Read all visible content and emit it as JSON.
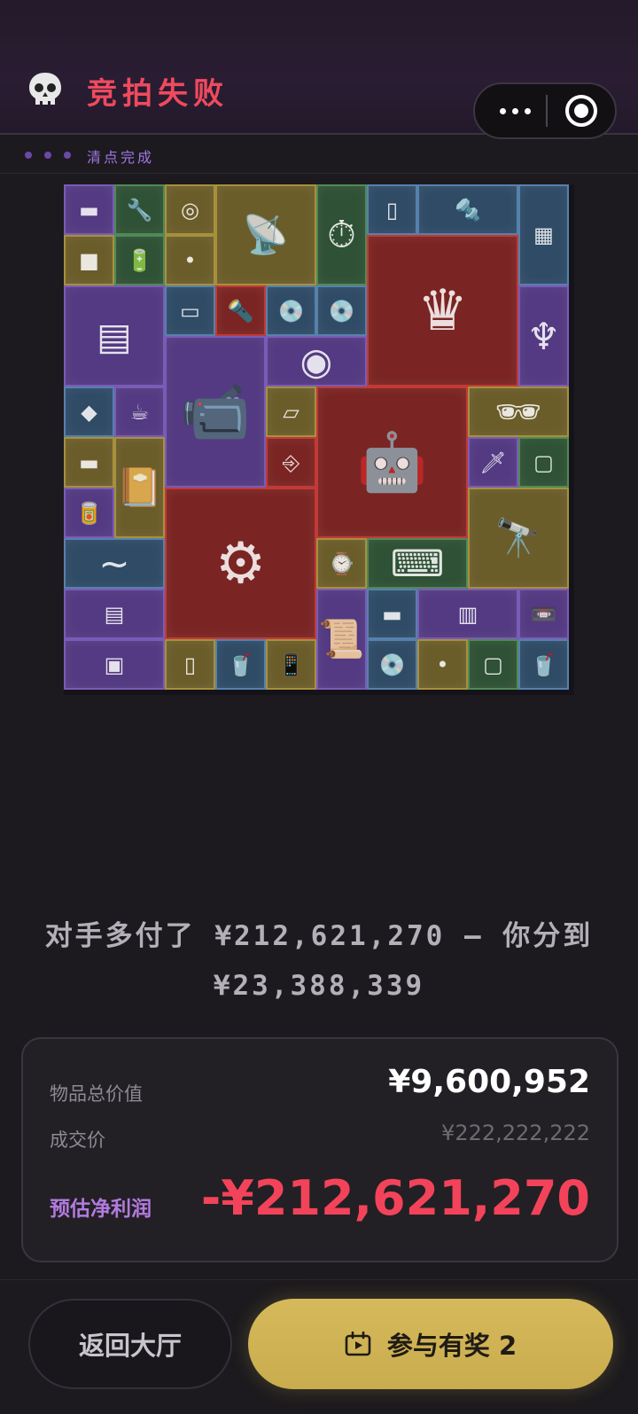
{
  "header": {
    "title": "竞拍失败",
    "status_text": "清点完成",
    "colors": {
      "title": "#ef4a5e",
      "status": "#a177e6"
    }
  },
  "capsule": {
    "more_icon": "more-dots-icon",
    "close_icon": "target-circle-icon"
  },
  "grid": {
    "items": [
      {
        "icon": "memory-stick",
        "glyph": "▬",
        "color": "purple"
      },
      {
        "icon": "wrench",
        "glyph": "🔧",
        "color": "green"
      },
      {
        "icon": "coin",
        "glyph": "◎",
        "color": "gold"
      },
      {
        "icon": "satellite-dish",
        "glyph": "📡",
        "color": "gold"
      },
      {
        "icon": "pressure-gauge",
        "glyph": "⏱",
        "color": "green"
      },
      {
        "icon": "handheld-device",
        "glyph": "▯",
        "color": "blue"
      },
      {
        "icon": "drill",
        "glyph": "🔩",
        "color": "blue"
      },
      {
        "icon": "gift-box",
        "glyph": "▦",
        "color": "blue"
      },
      {
        "icon": "cube",
        "glyph": "■",
        "color": "gold"
      },
      {
        "icon": "battery",
        "glyph": "🔋",
        "color": "green"
      },
      {
        "icon": "ammo",
        "glyph": "•",
        "color": "gold"
      },
      {
        "icon": "chess-board",
        "glyph": "♛",
        "color": "red"
      },
      {
        "icon": "motherboard",
        "glyph": "▤",
        "color": "purple"
      },
      {
        "icon": "ammo-can",
        "glyph": "▭",
        "color": "blue"
      },
      {
        "icon": "flashlight",
        "glyph": "🔦",
        "color": "red"
      },
      {
        "icon": "disc",
        "glyph": "💿",
        "color": "blue"
      },
      {
        "icon": "disc-2",
        "glyph": "💿",
        "color": "blue"
      },
      {
        "icon": "torch-statue",
        "glyph": "♆",
        "color": "purple"
      },
      {
        "icon": "camera-turret",
        "glyph": "📹",
        "color": "purple"
      },
      {
        "icon": "camera-lens",
        "glyph": "◉",
        "color": "purple"
      },
      {
        "icon": "pouch",
        "glyph": "◆",
        "color": "blue"
      },
      {
        "icon": "teacup",
        "glyph": "☕",
        "color": "purple"
      },
      {
        "icon": "ssd",
        "glyph": "▱",
        "color": "gold"
      },
      {
        "icon": "robot-vacuum",
        "glyph": "🤖",
        "color": "red"
      },
      {
        "icon": "sunglasses",
        "glyph": "🕶",
        "color": "gold"
      },
      {
        "icon": "usb-drive",
        "glyph": "⎆",
        "color": "red"
      },
      {
        "icon": "ram-chip",
        "glyph": "▬",
        "color": "gold"
      },
      {
        "icon": "leather-notebook",
        "glyph": "📔",
        "color": "gold"
      },
      {
        "icon": "dagger",
        "glyph": "🗡",
        "color": "purple"
      },
      {
        "icon": "hard-drive",
        "glyph": "▢",
        "color": "green"
      },
      {
        "icon": "soda-can",
        "glyph": "🥫",
        "color": "purple"
      },
      {
        "icon": "engine-block",
        "glyph": "⚙",
        "color": "red"
      },
      {
        "icon": "binoculars",
        "glyph": "🔭",
        "color": "gold"
      },
      {
        "icon": "pipe",
        "glyph": "~",
        "color": "blue"
      },
      {
        "icon": "pocket-watch",
        "glyph": "⌚",
        "color": "gold"
      },
      {
        "icon": "keyboard",
        "glyph": "⌨",
        "color": "green"
      },
      {
        "icon": "sound-card",
        "glyph": "▤",
        "color": "purple"
      },
      {
        "icon": "old-book",
        "glyph": "📜",
        "color": "purple"
      },
      {
        "icon": "ram-stick",
        "glyph": "▬",
        "color": "blue"
      },
      {
        "icon": "graphics-card",
        "glyph": "▥",
        "color": "purple"
      },
      {
        "icon": "cassette",
        "glyph": "📼",
        "color": "purple"
      },
      {
        "icon": "cpu-box",
        "glyph": "▣",
        "color": "purple"
      },
      {
        "icon": "spray-bottle",
        "glyph": "▯",
        "color": "gold"
      },
      {
        "icon": "cola-can",
        "glyph": "🥤",
        "color": "blue"
      },
      {
        "icon": "smartphone",
        "glyph": "📱",
        "color": "gold"
      },
      {
        "icon": "disc-3",
        "glyph": "💿",
        "color": "blue"
      },
      {
        "icon": "bullet",
        "glyph": "•",
        "color": "gold"
      },
      {
        "icon": "hdd",
        "glyph": "▢",
        "color": "green"
      },
      {
        "icon": "cola-can-2",
        "glyph": "🥤",
        "color": "blue"
      }
    ]
  },
  "message": {
    "line1": "对手多付了 ¥212,621,270 — 你分到",
    "line2": "¥23,388,339"
  },
  "summary": {
    "total_label": "物品总价值",
    "total_value": "¥9,600,952",
    "deal_label": "成交价",
    "deal_value": "¥222,222,222",
    "profit_label": "预估净利润",
    "profit_value": "-¥212,621,270",
    "colors": {
      "profit": "#f3435a",
      "profit_label": "#b37ae0"
    }
  },
  "footer": {
    "back_label": "返回大厅",
    "join_label": "参与有奖 2",
    "join_icon": "ticket-play-icon"
  }
}
